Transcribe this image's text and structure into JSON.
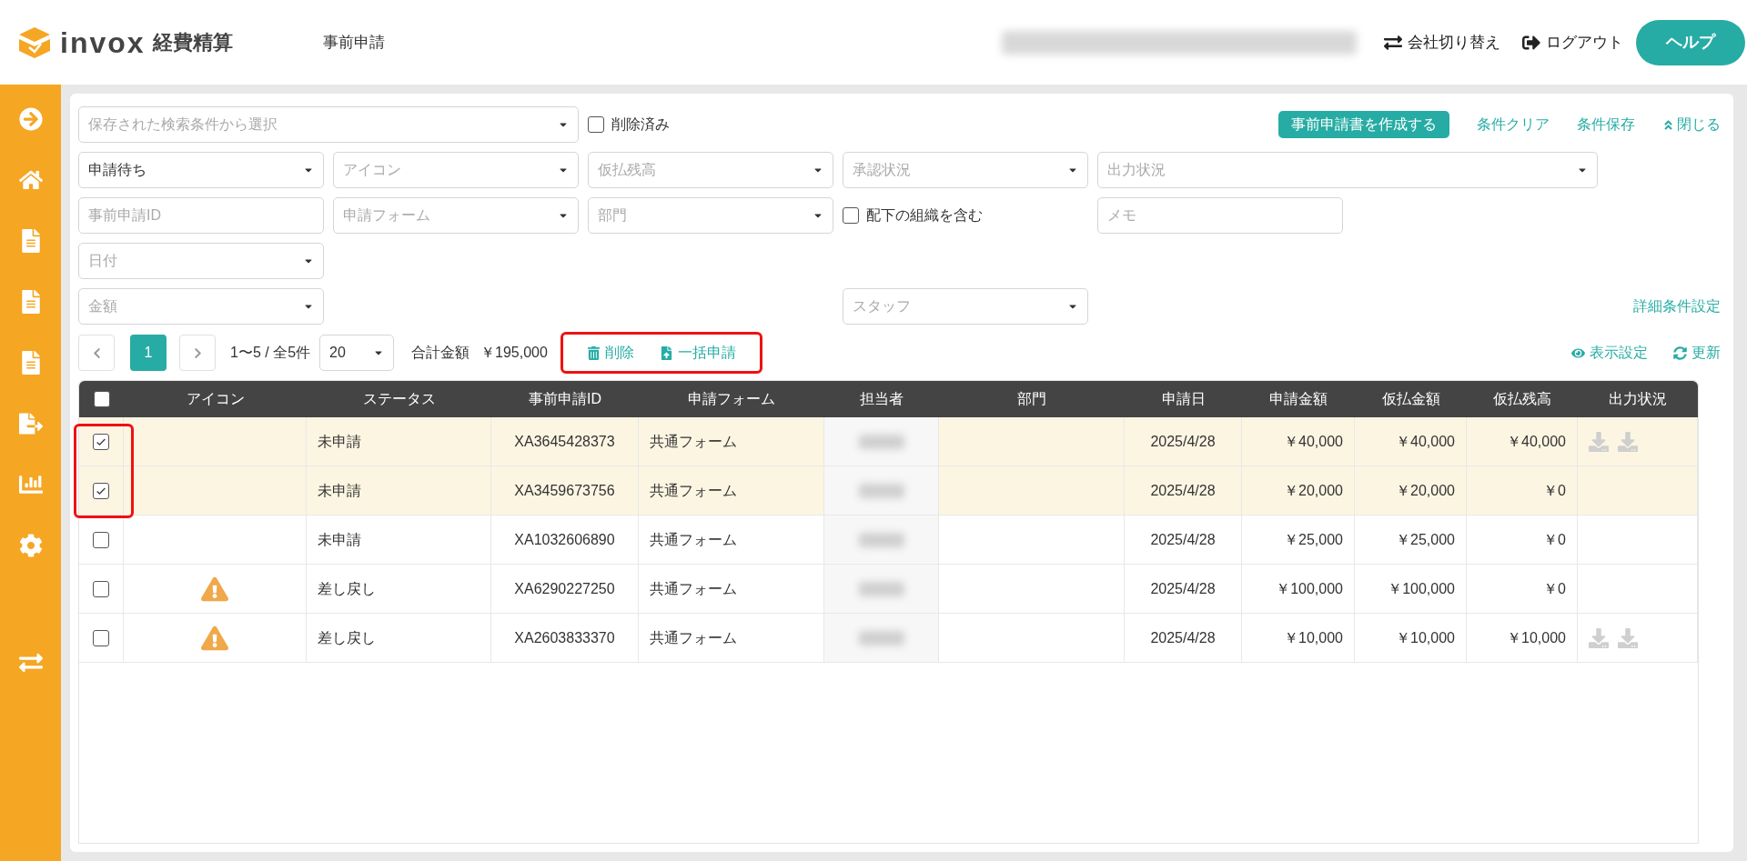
{
  "header": {
    "logo_text": "invox",
    "logo_subtitle": "経費精算",
    "page_title": "事前申請",
    "actions": [
      {
        "kind": "switch",
        "label": "会社切り替え"
      },
      {
        "kind": "logout",
        "label": "ログアウト"
      }
    ],
    "help_button": "ヘルプ"
  },
  "search_actions": [
    {
      "kind": "button",
      "label": "事前申請書を作成する"
    },
    {
      "kind": "link",
      "label": "条件クリア"
    },
    {
      "kind": "link",
      "label": "条件保存"
    },
    {
      "kind": "collapse",
      "label": "閉じる"
    }
  ],
  "filters": [
    [
      {
        "kind": "select",
        "placeholder": "保存された検索条件から選択"
      },
      {
        "kind": "checkbox",
        "label": "削除済み",
        "checked": false
      }
    ],
    [
      {
        "kind": "select",
        "value": "申請待ち"
      },
      {
        "kind": "select",
        "placeholder": "アイコン"
      },
      {
        "kind": "select",
        "placeholder": "仮払残高"
      },
      {
        "kind": "select",
        "placeholder": "承認状況"
      },
      {
        "kind": "select",
        "placeholder": "出力状況"
      }
    ],
    [
      {
        "kind": "input",
        "placeholder": "事前申請ID"
      },
      {
        "kind": "select",
        "placeholder": "申請フォーム"
      },
      {
        "kind": "select",
        "placeholder": "部門"
      },
      {
        "kind": "checkbox",
        "label": "配下の組織を含む",
        "checked": false
      },
      {
        "kind": "input",
        "placeholder": "メモ"
      }
    ],
    [
      {
        "kind": "select",
        "placeholder": "日付"
      }
    ],
    [
      {
        "kind": "select",
        "placeholder": "金額"
      },
      {
        "kind": "select",
        "placeholder": "スタッフ"
      },
      {
        "kind": "link",
        "label": "詳細条件設定"
      }
    ]
  ],
  "toolbar": {
    "page": "1",
    "range": "1〜5 / 全5件",
    "per_page": "20",
    "total_label": "合計金額",
    "total": "￥195,000",
    "bulk_actions": [
      {
        "kind": "delete",
        "label": "削除"
      },
      {
        "kind": "submit",
        "label": "一括申請"
      }
    ],
    "bulk_highlighted": true,
    "view_actions": [
      {
        "kind": "view",
        "label": "表示設定"
      },
      {
        "kind": "refresh",
        "label": "更新"
      }
    ]
  },
  "table": {
    "select_all_checked": false,
    "checkbox_highlighted": true,
    "columns": [
      "アイコン",
      "ステータス",
      "事前申請ID",
      "申請フォーム",
      "担当者",
      "部門",
      "申請日",
      "申請金額",
      "仮払金額",
      "仮払残高",
      "出力状況"
    ],
    "rows": [
      {
        "checked": true,
        "warning": false,
        "status": "未申請",
        "id": "XA3645428373",
        "form": "共通フォーム",
        "date": "2025/4/28",
        "amount": "￥40,000",
        "advance": "￥40,000",
        "balance": "￥40,000",
        "output_available": true
      },
      {
        "checked": true,
        "warning": false,
        "status": "未申請",
        "id": "XA3459673756",
        "form": "共通フォーム",
        "date": "2025/4/28",
        "amount": "￥20,000",
        "advance": "￥20,000",
        "balance": "￥0",
        "output_available": false
      },
      {
        "checked": false,
        "warning": false,
        "status": "未申請",
        "id": "XA1032606890",
        "form": "共通フォーム",
        "date": "2025/4/28",
        "amount": "￥25,000",
        "advance": "￥25,000",
        "balance": "￥0",
        "output_available": false
      },
      {
        "checked": false,
        "warning": true,
        "status": "差し戻し",
        "id": "XA6290227250",
        "form": "共通フォーム",
        "date": "2025/4/28",
        "amount": "￥100,000",
        "advance": "￥100,000",
        "balance": "￥0",
        "output_available": false
      },
      {
        "checked": false,
        "warning": true,
        "status": "差し戻し",
        "id": "XA2603833370",
        "form": "共通フォーム",
        "date": "2025/4/28",
        "amount": "￥10,000",
        "advance": "￥10,000",
        "balance": "￥10,000",
        "output_available": true
      }
    ]
  }
}
